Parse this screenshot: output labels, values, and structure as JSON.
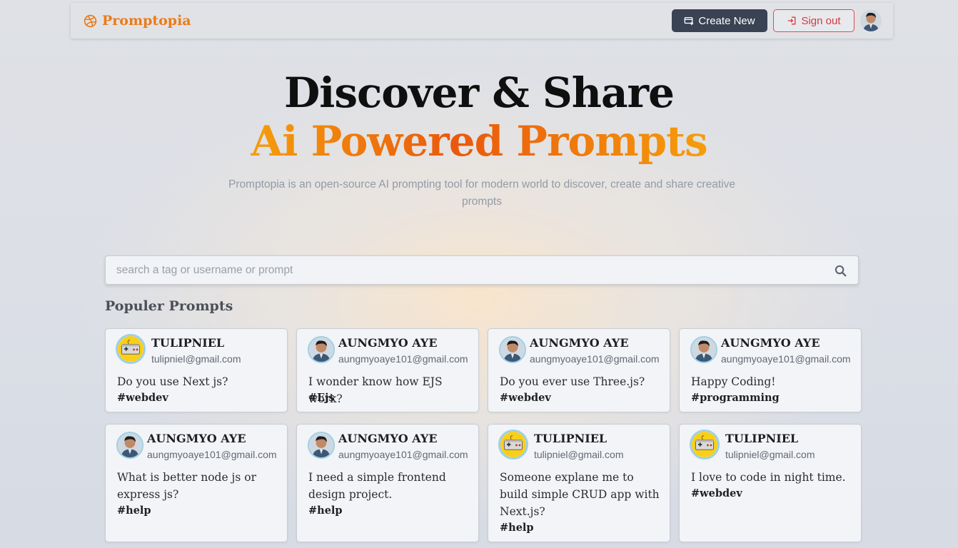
{
  "brand": {
    "name": "Promptopia"
  },
  "nav": {
    "create_label": "Create New",
    "signout_label": "Sign out"
  },
  "hero": {
    "line1": "Discover & Share",
    "line2": "Ai Powered Prompts",
    "description": "Promptopia is an open-source AI prompting tool for modern world to discover, create and share creative prompts"
  },
  "search": {
    "placeholder": "search a tag or username or prompt",
    "value": ""
  },
  "section": {
    "title": "Populer Prompts"
  },
  "colors": {
    "brand": "#ea7b18",
    "dark_button": "#3a4354",
    "signout": "#d23b3f",
    "gradient_from": "#f59e0b",
    "gradient_to": "#ea580c"
  },
  "cards": [
    {
      "username": "TULIPNIEL",
      "email": "tulipniel@gmail.com",
      "prompt": "Do you use Next js?",
      "tag": "#webdev",
      "avatar": "gamepad-avatar-icon"
    },
    {
      "username": "AUNGMYO AYE",
      "email": "aungmyoaye101@gmail.com",
      "prompt": "I wonder know how EJS work?",
      "tag": "#Ejs",
      "avatar": "user-photo-avatar-icon"
    },
    {
      "username": "AUNGMYO AYE",
      "email": "aungmyoaye101@gmail.com",
      "prompt": "Do you ever use Three.js?",
      "tag": "#webdev",
      "avatar": "user-photo-avatar-icon"
    },
    {
      "username": "AUNGMYO AYE",
      "email": "aungmyoaye101@gmail.com",
      "prompt": "Happy Coding!",
      "tag": "#programming",
      "avatar": "user-photo-avatar-icon"
    },
    {
      "username": "AUNGMYO AYE",
      "email": "aungmyoaye101@gmail.com",
      "prompt": "What is better node js or express js?",
      "tag": "#help",
      "avatar": "user-photo-avatar-icon"
    },
    {
      "username": "AUNGMYO AYE",
      "email": "aungmyoaye101@gmail.com",
      "prompt": "I need a simple frontend design project.",
      "tag": "#help",
      "avatar": "user-photo-avatar-icon"
    },
    {
      "username": "TULIPNIEL",
      "email": "tulipniel@gmail.com",
      "prompt": "Someone explane me to build simple CRUD app with Next.js?",
      "tag": "#help",
      "avatar": "gamepad-avatar-icon"
    },
    {
      "username": "TULIPNIEL",
      "email": "tulipniel@gmail.com",
      "prompt": "I love to code in night time.",
      "tag": "#webdev",
      "avatar": "gamepad-avatar-icon"
    }
  ]
}
